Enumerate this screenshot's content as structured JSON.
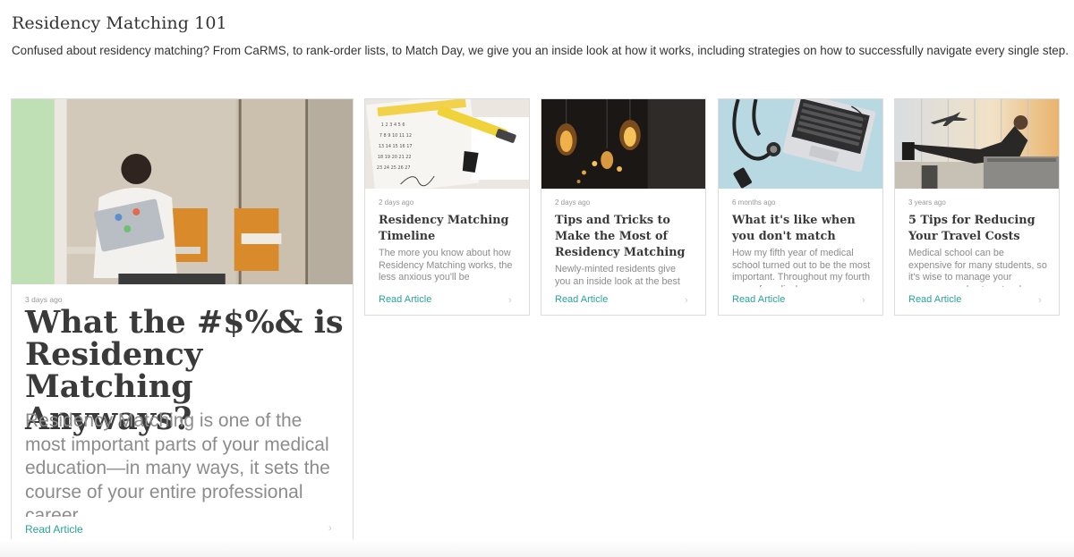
{
  "section": {
    "title": "Residency Matching 101",
    "description": "Confused about residency matching? From CaRMS, to rank-order lists, to Match Day, we give you an inside look at how it works, including strategies on how to successfully navigate every single step."
  },
  "featured": {
    "date": "3 days ago",
    "title": "What the #$%& is Residency Matching Anyways?",
    "excerpt": "Residency Matching is one of the most important parts of your medical education—in many ways, it sets the course of your entire professional career",
    "read_label": "Read Article"
  },
  "articles": [
    {
      "date": "2 days ago",
      "title": "Residency Matching Timeline",
      "excerpt": "The more you know about how Residency Matching works, the less anxious you'll be",
      "read_label": "Read Article"
    },
    {
      "date": "2 days ago",
      "title": "Tips and Tricks to Make the Most of Residency Matching",
      "excerpt": "Newly-minted residents give you an inside look at the best",
      "read_label": "Read Article"
    },
    {
      "date": "6 months ago",
      "title": "What it's like when you don't match",
      "excerpt": "How my fifth year of medical school turned out to be the most important. Throughout my fourth year of medical",
      "read_label": "Read Article"
    },
    {
      "date": "3 years ago",
      "title": "5 Tips for Reducing Your Travel Costs",
      "excerpt": "Medical school can be expensive for many students, so it's wise to manage your expenses and cut costs where",
      "read_label": "Read Article"
    }
  ],
  "colors": {
    "accent": "#2aa199",
    "card_border": "#dcdcdc",
    "muted_text": "#8c8c8c"
  }
}
